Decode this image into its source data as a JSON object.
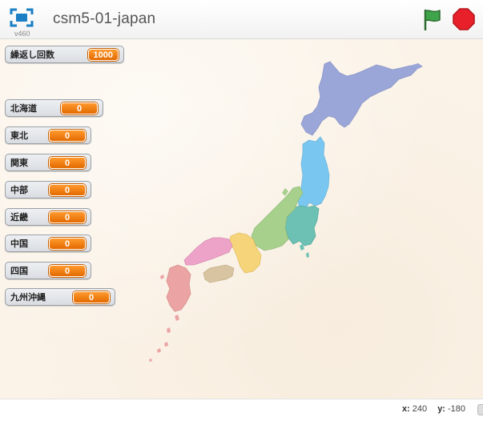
{
  "header": {
    "title": "csm5-01-japan",
    "version": "v460"
  },
  "monitors": {
    "repeat": {
      "label": "繰返し回数",
      "value": "1000"
    },
    "regions": [
      {
        "label": "北海道",
        "value": "0"
      },
      {
        "label": "東北",
        "value": "0"
      },
      {
        "label": "関東",
        "value": "0"
      },
      {
        "label": "中部",
        "value": "0"
      },
      {
        "label": "近畿",
        "value": "0"
      },
      {
        "label": "中国",
        "value": "0"
      },
      {
        "label": "四国",
        "value": "0"
      },
      {
        "label": "九州沖縄",
        "value": "0"
      }
    ]
  },
  "footer": {
    "x_label": "x:",
    "x_value": "240",
    "y_label": "y:",
    "y_value": "-180"
  },
  "colors": {
    "hokkaido": "#9aa6d8",
    "tohoku": "#79c7f0",
    "kanto": "#6cc0b4",
    "chubu": "#a8d08d",
    "kinki": "#f6d47a",
    "chugoku": "#eda2c8",
    "shikoku": "#d8c4a0",
    "kyushu": "#eba3a3",
    "monitor_value": "#f07f0e",
    "flag": "#2f9a3a",
    "stop": "#e8202a"
  }
}
